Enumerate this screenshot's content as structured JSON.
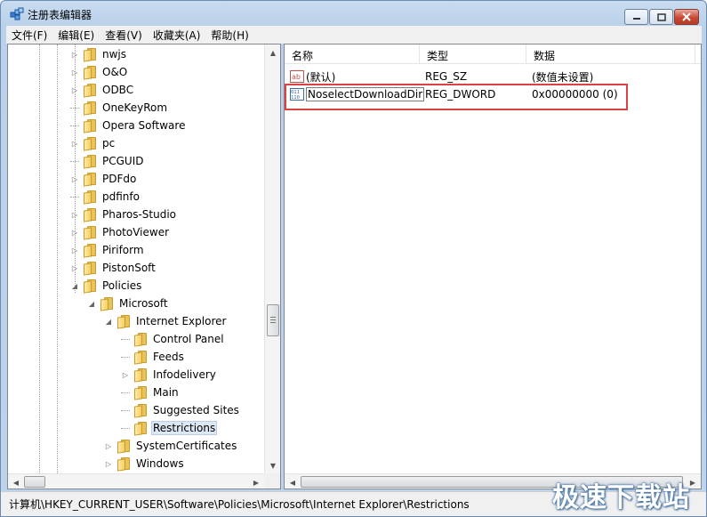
{
  "window": {
    "title": "注册表编辑器"
  },
  "menu": [
    "文件(F)",
    "编辑(E)",
    "查看(V)",
    "收藏夹(A)",
    "帮助(H)"
  ],
  "tree": {
    "items": [
      {
        "label": "nwjs",
        "expandable": true,
        "level": 0
      },
      {
        "label": "O&O",
        "expandable": true,
        "level": 0
      },
      {
        "label": "ODBC",
        "expandable": true,
        "level": 0
      },
      {
        "label": "OneKeyRom",
        "expandable": false,
        "level": 0
      },
      {
        "label": "Opera Software",
        "expandable": false,
        "level": 0
      },
      {
        "label": "pc",
        "expandable": true,
        "level": 0
      },
      {
        "label": "PCGUID",
        "expandable": false,
        "level": 0
      },
      {
        "label": "PDFdo",
        "expandable": true,
        "level": 0
      },
      {
        "label": "pdfinfo",
        "expandable": false,
        "level": 0
      },
      {
        "label": "Pharos-Studio",
        "expandable": true,
        "level": 0
      },
      {
        "label": "PhotoViewer",
        "expandable": true,
        "level": 0
      },
      {
        "label": "Piriform",
        "expandable": true,
        "level": 0
      },
      {
        "label": "PistonSoft",
        "expandable": true,
        "level": 0
      },
      {
        "label": "Policies",
        "expandable": true,
        "expanded": true,
        "level": 0
      },
      {
        "label": "Microsoft",
        "expandable": true,
        "expanded": true,
        "level": 1
      },
      {
        "label": "Internet Explorer",
        "expandable": true,
        "expanded": true,
        "level": 2
      },
      {
        "label": "Control Panel",
        "expandable": false,
        "level": 3
      },
      {
        "label": "Feeds",
        "expandable": false,
        "level": 3
      },
      {
        "label": "Infodelivery",
        "expandable": true,
        "level": 3
      },
      {
        "label": "Main",
        "expandable": false,
        "level": 3
      },
      {
        "label": "Suggested Sites",
        "expandable": false,
        "level": 3
      },
      {
        "label": "Restrictions",
        "expandable": false,
        "level": 3,
        "selected": true
      },
      {
        "label": "SystemCertificates",
        "expandable": true,
        "level": 2
      },
      {
        "label": "Windows",
        "expandable": true,
        "level": 2
      }
    ]
  },
  "list": {
    "columns": [
      "名称",
      "类型",
      "数据"
    ],
    "rows": [
      {
        "icon": "string-value-icon",
        "name": "(默认)",
        "type": "REG_SZ",
        "data": "(数值未设置)"
      },
      {
        "icon": "dword-value-icon",
        "name": "NoselectDownloadDir",
        "type": "REG_DWORD",
        "data": "0x00000000 (0)",
        "editing": true
      }
    ]
  },
  "status": {
    "path": "计算机\\HKEY_CURRENT_USER\\Software\\Policies\\Microsoft\\Internet Explorer\\Restrictions"
  },
  "watermark": "极速下载站",
  "colors": {
    "highlight": "#d94343",
    "selection": "#dde8f5"
  }
}
